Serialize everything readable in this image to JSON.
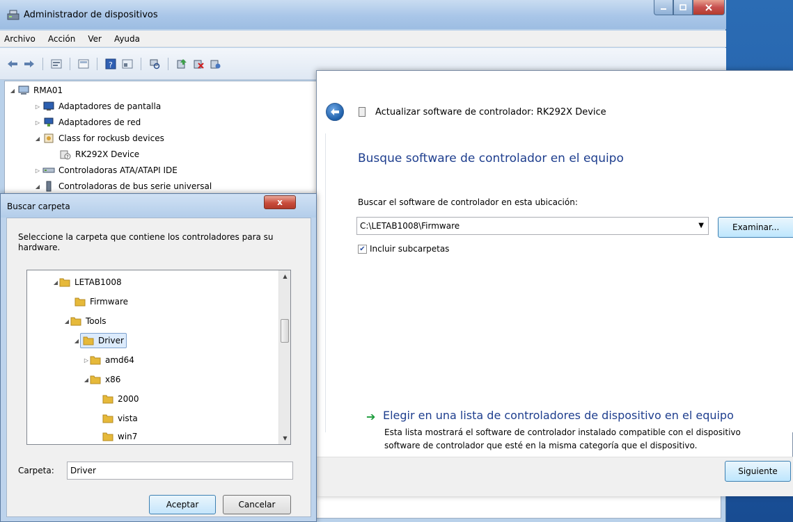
{
  "main_window": {
    "title": "Administrador de dispositivos",
    "menu": [
      "Archivo",
      "Acción",
      "Ver",
      "Ayuda"
    ],
    "tree": {
      "root": "RMA01",
      "items": [
        "Adaptadores de pantalla",
        "Adaptadores de red",
        "Class for rockusb devices",
        "RK292X Device",
        "Controladoras ATA/ATAPI IDE",
        "Controladoras de bus serie universal"
      ]
    }
  },
  "update_dialog": {
    "header": "Actualizar software de controlador: RK292X Device",
    "heading": "Busque software de controlador en el equipo",
    "location_label": "Buscar el software de controlador en esta ubicación:",
    "path_value": "C:\\LETAB1008\\Firmware",
    "browse_label": "Examinar...",
    "include_subfolders": "Incluir subcarpetas",
    "include_subfolders_checked": true,
    "choose_link": "Elegir en una lista de controladores de dispositivo en el equipo",
    "choose_desc_1": "Esta lista mostrará el software de controlador instalado compatible con el dispositivo",
    "choose_desc_2": "software de controlador que esté en la misma categoría que el dispositivo.",
    "next_label": "Siguiente"
  },
  "browse_dialog": {
    "title": "Buscar carpeta",
    "close_label": "x",
    "instruction": "Seleccione la carpeta que contiene los controladores para su hardware.",
    "tree": [
      "LETAB1008",
      "Firmware",
      "Tools",
      "Driver",
      "amd64",
      "x86",
      "2000",
      "vista",
      "win7"
    ],
    "selected": "Driver",
    "folder_label": "Carpeta:",
    "folder_value": "Driver",
    "ok_label": "Aceptar",
    "cancel_label": "Cancelar"
  },
  "colors": {
    "link_blue": "#1e3e8e",
    "folder_yellow": "#e6b93a",
    "selection": "#dcebfc"
  }
}
